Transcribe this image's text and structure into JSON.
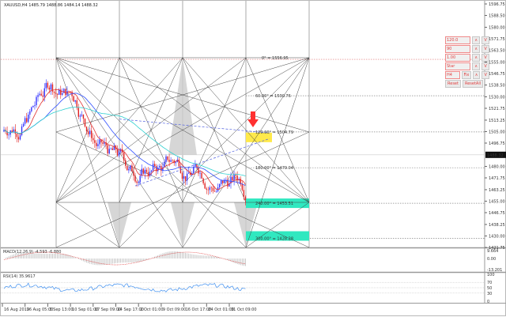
{
  "title": "XAUUSD,H4  1485.79 1488.86 1484.14 1488.32",
  "price_axis": [
    "1596.75",
    "1588.50",
    "1580.00",
    "1571.75",
    "1563.50",
    "1555.00",
    "1546.75",
    "1538.50",
    "1530.00",
    "1521.75",
    "1513.25",
    "1505.00",
    "1496.75",
    "1480.00",
    "1471.75",
    "1463.25",
    "1455.00",
    "1446.75",
    "1438.25",
    "1430.00",
    "1421.75"
  ],
  "current_price": "1488.32",
  "gann_levels": [
    {
      "label": "0° = 1556.95",
      "price": 1556.95
    },
    {
      "label": "60.00° = 1530.76",
      "price": 1530.76
    },
    {
      "label": "120.00° = 1504.79",
      "price": 1504.79
    },
    {
      "label": "180.00° = 1479.04",
      "price": 1479.04
    },
    {
      "label": "240.00° = 1453.51",
      "price": 1453.51
    },
    {
      "label": "300.00° = 1428.28",
      "price": 1428.28
    }
  ],
  "macd": {
    "label": "MACD(12,26,9) -4.593 -6.880",
    "axis": [
      "9.664",
      "0.00",
      "-13.201"
    ]
  },
  "rsi": {
    "label": "RSI(14) 35.9617",
    "axis": [
      "100",
      "70",
      "50",
      "30",
      "0"
    ]
  },
  "time_axis": [
    "16 Aug 2019",
    "26 Aug 05:00",
    "3 Sep 13:00",
    "10 Sep 01:00",
    "17 Sep 09:00",
    "24 Sep 17:00",
    "2 Oct 01:00",
    "9 Oct 09:00",
    "16 Oct 17:00",
    "24 Oct 01:00",
    "31 Oct 09:00"
  ],
  "panel": {
    "angle": "120.0",
    "step": "90",
    "scale": "1.00",
    "mode": "Star",
    "timeframe": "H4",
    "fix": "Fix",
    "up": "∧",
    "down": "V",
    "reset": "Reset",
    "reset_all": "ResetAll"
  },
  "colors": {
    "bull": "#3333ff",
    "bear": "#e02020",
    "ma_red": "#e03030",
    "ma_blue": "#3050ff",
    "ma_cyan": "#30d0d0",
    "gann_yellow": "#ffe94a",
    "gann_cyan": "#30e8c0",
    "arrow": "#ff3030"
  }
}
